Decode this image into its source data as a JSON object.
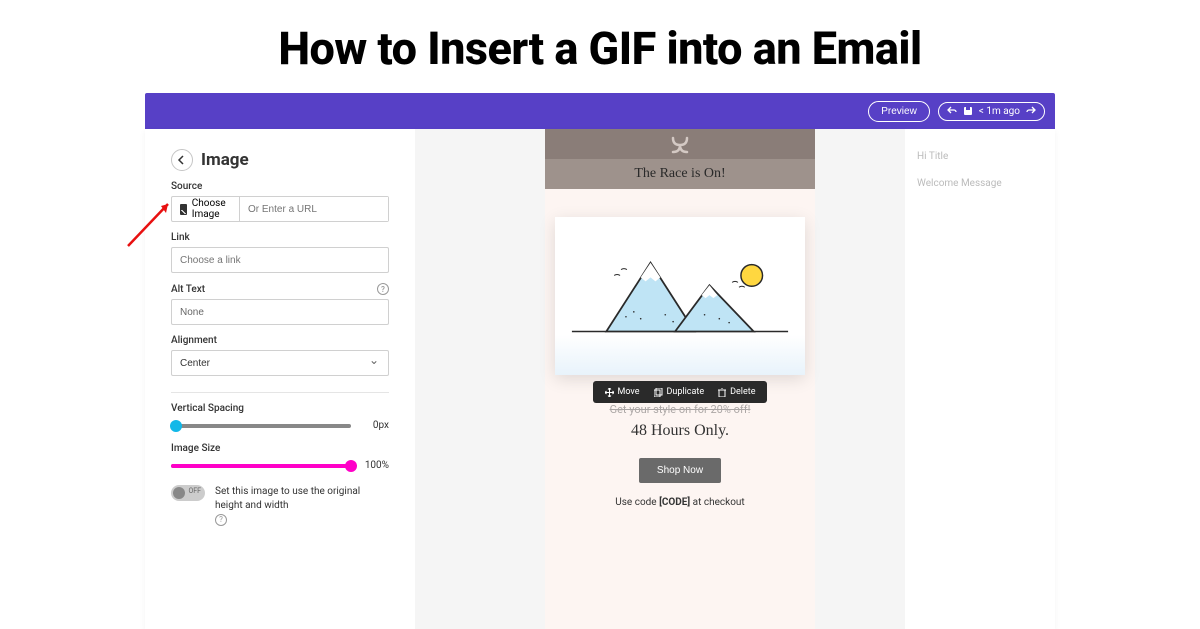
{
  "page": {
    "title": "How to Insert a GIF into an Email"
  },
  "topbar": {
    "preview_label": "Preview",
    "history_label": "< 1m ago"
  },
  "panel": {
    "title": "Image",
    "source_label": "Source",
    "choose_image_label": "Choose Image",
    "url_placeholder": "Or Enter a URL",
    "link_label": "Link",
    "link_placeholder": "Choose a link",
    "alt_label": "Alt Text",
    "alt_value": "None",
    "alignment_label": "Alignment",
    "alignment_value": "Center",
    "vspacing_label": "Vertical Spacing",
    "vspacing_value": "0px",
    "vspacing_percent": 3,
    "vspacing_color": "#12b8e8",
    "imgsize_label": "Image Size",
    "imgsize_value": "100%",
    "imgsize_percent": 100,
    "imgsize_color": "#ff00c8",
    "toggle_label": "OFF",
    "toggle_text": "Set this image to use the original height and width"
  },
  "email": {
    "title": "The Race is On!",
    "actions": {
      "move": "Move",
      "duplicate": "Duplicate",
      "delete": "Delete"
    },
    "promo_line": "Get your style on for 20% off!",
    "hours": "48 Hours Only.",
    "shop_label": "Shop Now",
    "code_prefix": "Use code ",
    "code": "[CODE]",
    "code_suffix": " at checkout"
  },
  "right_panel": {
    "item1": "Hi Title",
    "item2": "Welcome Message"
  }
}
